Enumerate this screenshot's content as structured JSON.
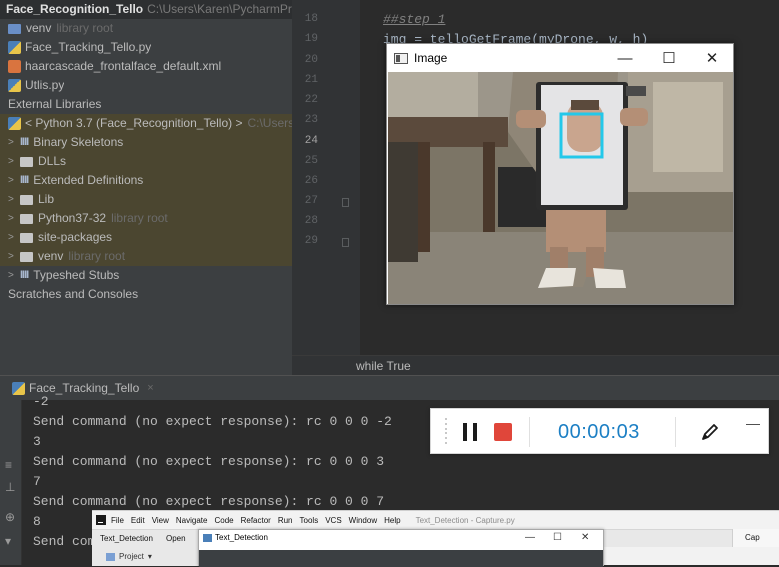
{
  "project_tree": {
    "root_name": "Face_Recognition_Tello",
    "root_path": "C:\\Users\\Karen\\PycharmProjec",
    "items": [
      {
        "label": "venv",
        "suffix": "library root",
        "type": "folder-blue"
      },
      {
        "label": "Face_Tracking_Tello.py",
        "suffix": "",
        "type": "python"
      },
      {
        "label": "haarcascade_frontalface_default.xml",
        "suffix": "",
        "type": "xml"
      },
      {
        "label": "Utlis.py",
        "suffix": "",
        "type": "python"
      }
    ],
    "external_libraries": "External Libraries",
    "python_sdk": {
      "label": "< Python 3.7 (Face_Recognition_Tello) >",
      "path": "C:\\Users\\Ka"
    },
    "sdk_items": [
      {
        "label": "Binary Skeletons",
        "suffix": "",
        "type": "lib"
      },
      {
        "label": "DLLs",
        "suffix": "",
        "type": "folder"
      },
      {
        "label": "Extended Definitions",
        "suffix": "",
        "type": "lib"
      },
      {
        "label": "Lib",
        "suffix": "",
        "type": "folder"
      },
      {
        "label": "Python37-32",
        "suffix": "library root",
        "type": "folder"
      },
      {
        "label": "site-packages",
        "suffix": "",
        "type": "folder"
      },
      {
        "label": "venv",
        "suffix": "library root",
        "type": "folder"
      },
      {
        "label": "Typeshed Stubs",
        "suffix": "",
        "type": "lib"
      }
    ],
    "scratches": "Scratches and Consoles"
  },
  "editor": {
    "line_numbers": [
      "18",
      "19",
      "20",
      "21",
      "22",
      "23",
      "24",
      "25",
      "26",
      "27",
      "28",
      "29"
    ],
    "current_line": "24",
    "code_comment": "##step 1",
    "code_line": "img = telloGetFrame(myDrone, w, h)",
    "breadcrumb": "while True"
  },
  "image_window": {
    "title": "Image",
    "minimize": "—",
    "maximize": "☐",
    "close": "✕"
  },
  "run_panel": {
    "tab_label": "Face_Tracking_Tello",
    "tab_close": "×",
    "lines": [
      "-2",
      "Send command (no expect response): rc 0 0 0 -2",
      "3",
      "Send command (no expect response): rc 0 0 0 3",
      "7",
      "Send command (no expect response): rc 0 0 0 7",
      "8",
      "Send com"
    ]
  },
  "recorder": {
    "timer": "00:00:03",
    "minimize": "—"
  },
  "second_ide": {
    "menu": [
      "File",
      "Edit",
      "View",
      "Navigate",
      "Code",
      "Refactor",
      "Run",
      "Tools",
      "VCS",
      "Window",
      "Help"
    ],
    "project_title": "Text_Detection - Capture.py",
    "tabs": [
      "Text_Detection",
      "Open"
    ],
    "project_dropdown": "Project",
    "window_title": "Text_Detection",
    "right_tab": "Cap",
    "win_min": "—",
    "win_max": "☐",
    "win_close": "✕"
  }
}
